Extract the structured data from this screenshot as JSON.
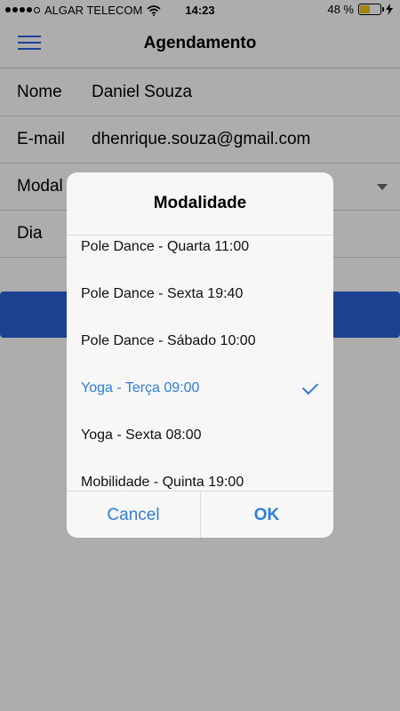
{
  "status_bar": {
    "carrier": "ALGAR TELECOM",
    "time": "14:23",
    "battery_percent": "48 %",
    "battery_level": 0.48,
    "battery_color": "#f1c40f"
  },
  "nav": {
    "title": "Agendamento"
  },
  "form": {
    "nome_label": "Nome",
    "nome_value": "Daniel Souza",
    "email_label": "E-mail",
    "email_value": "dhenrique.souza@gmail.com",
    "modalidade_label": "Modal",
    "dia_label": "Dia"
  },
  "dialog": {
    "title": "Modalidade",
    "options": [
      "Pole Dance - Quarta 11:00",
      "Pole Dance - Sexta 19:40",
      "Pole Dance - Sábado 10:00",
      "Yoga - Terça 09:00",
      "Yoga - Sexta 08:00",
      "Mobilidade - Quinta 19:00"
    ],
    "selected_index": 3,
    "cancel_label": "Cancel",
    "ok_label": "OK"
  },
  "colors": {
    "accent": "#2f7de0",
    "nav_icon": "#2a62d6",
    "submit_button": "#2a62d6"
  },
  "icons": {
    "menu": "hamburger-menu-icon",
    "signal": "signal-dots-icon",
    "wifi": "wifi-icon",
    "battery": "battery-icon",
    "charging": "charging-bolt-icon",
    "dropdown": "chevron-down-icon",
    "selected": "checkmark-icon"
  }
}
